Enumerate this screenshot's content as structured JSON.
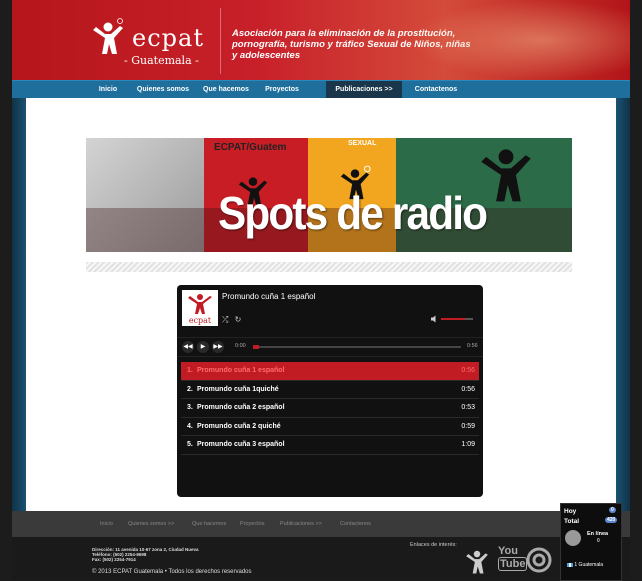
{
  "header": {
    "logo_text": "ecpat",
    "logo_sub": "- Guatemala -",
    "tagline": "Asociación para la eliminación de la prostitución, pornografía, turismo y tráfico Sexual de Niños, niñas y adolescentes"
  },
  "nav": {
    "items": [
      {
        "label": "Inicio"
      },
      {
        "label": "Quienes somos >>"
      },
      {
        "label": "Que hacemos"
      },
      {
        "label": "Proyectos"
      },
      {
        "label": "Publicaciones >>"
      },
      {
        "label": "Contactenos"
      }
    ],
    "active_index": 4
  },
  "banner": {
    "title": "Spots de radio",
    "tag1": "ECPAT/Guatem",
    "tag2": "SEXUAL"
  },
  "player": {
    "now_playing": "Promundo cuña 1 español",
    "cover_text": "ecpat",
    "current_time": "0:00",
    "total_time": "0:56",
    "progress": 0.03,
    "volume": 0.75,
    "tracks": [
      {
        "num": "1.",
        "name": "Promundo cuña 1 español",
        "duration": "0:56",
        "active": true
      },
      {
        "num": "2.",
        "name": "Promundo cuña 1quiché",
        "duration": "0:56",
        "active": false
      },
      {
        "num": "3.",
        "name": "Promundo cuña 2 español",
        "duration": "0:53",
        "active": false
      },
      {
        "num": "4.",
        "name": "Promundo cuña 2 quiché",
        "duration": "0:59",
        "active": false
      },
      {
        "num": "5.",
        "name": "Promundo cuña 3 español",
        "duration": "1:09",
        "active": false
      }
    ]
  },
  "footer": {
    "links": [
      "Inicio",
      "Quienes somos >>",
      "Que hacemos",
      "Proyectos",
      "Publicaciones >>",
      "Contactenos"
    ],
    "address_line1": "Dirección: 11 avenida 10-67 zona 2, Ciudad Nueva",
    "address_line2": "Teléfono: (502) 2254-8698",
    "address_line3": "Fax: (502) 2254-7914",
    "copyright": "© 2013 ECPAT Guatemala • Todos los derechos reservados",
    "enlaces_label": "Enlaces de interés:",
    "youtube_text1": "You",
    "youtube_text2": "Tube"
  },
  "widget": {
    "hoy": "Hoy",
    "total": "Total",
    "hoy_count": "0",
    "total_count": "420",
    "en_linea": "En línea",
    "en_linea_count": "0",
    "country": "1 Guatemala"
  },
  "colors": {
    "brand_red": "#c11c23",
    "nav_blue": "#1f6f9d",
    "nav_active": "#19364a"
  }
}
